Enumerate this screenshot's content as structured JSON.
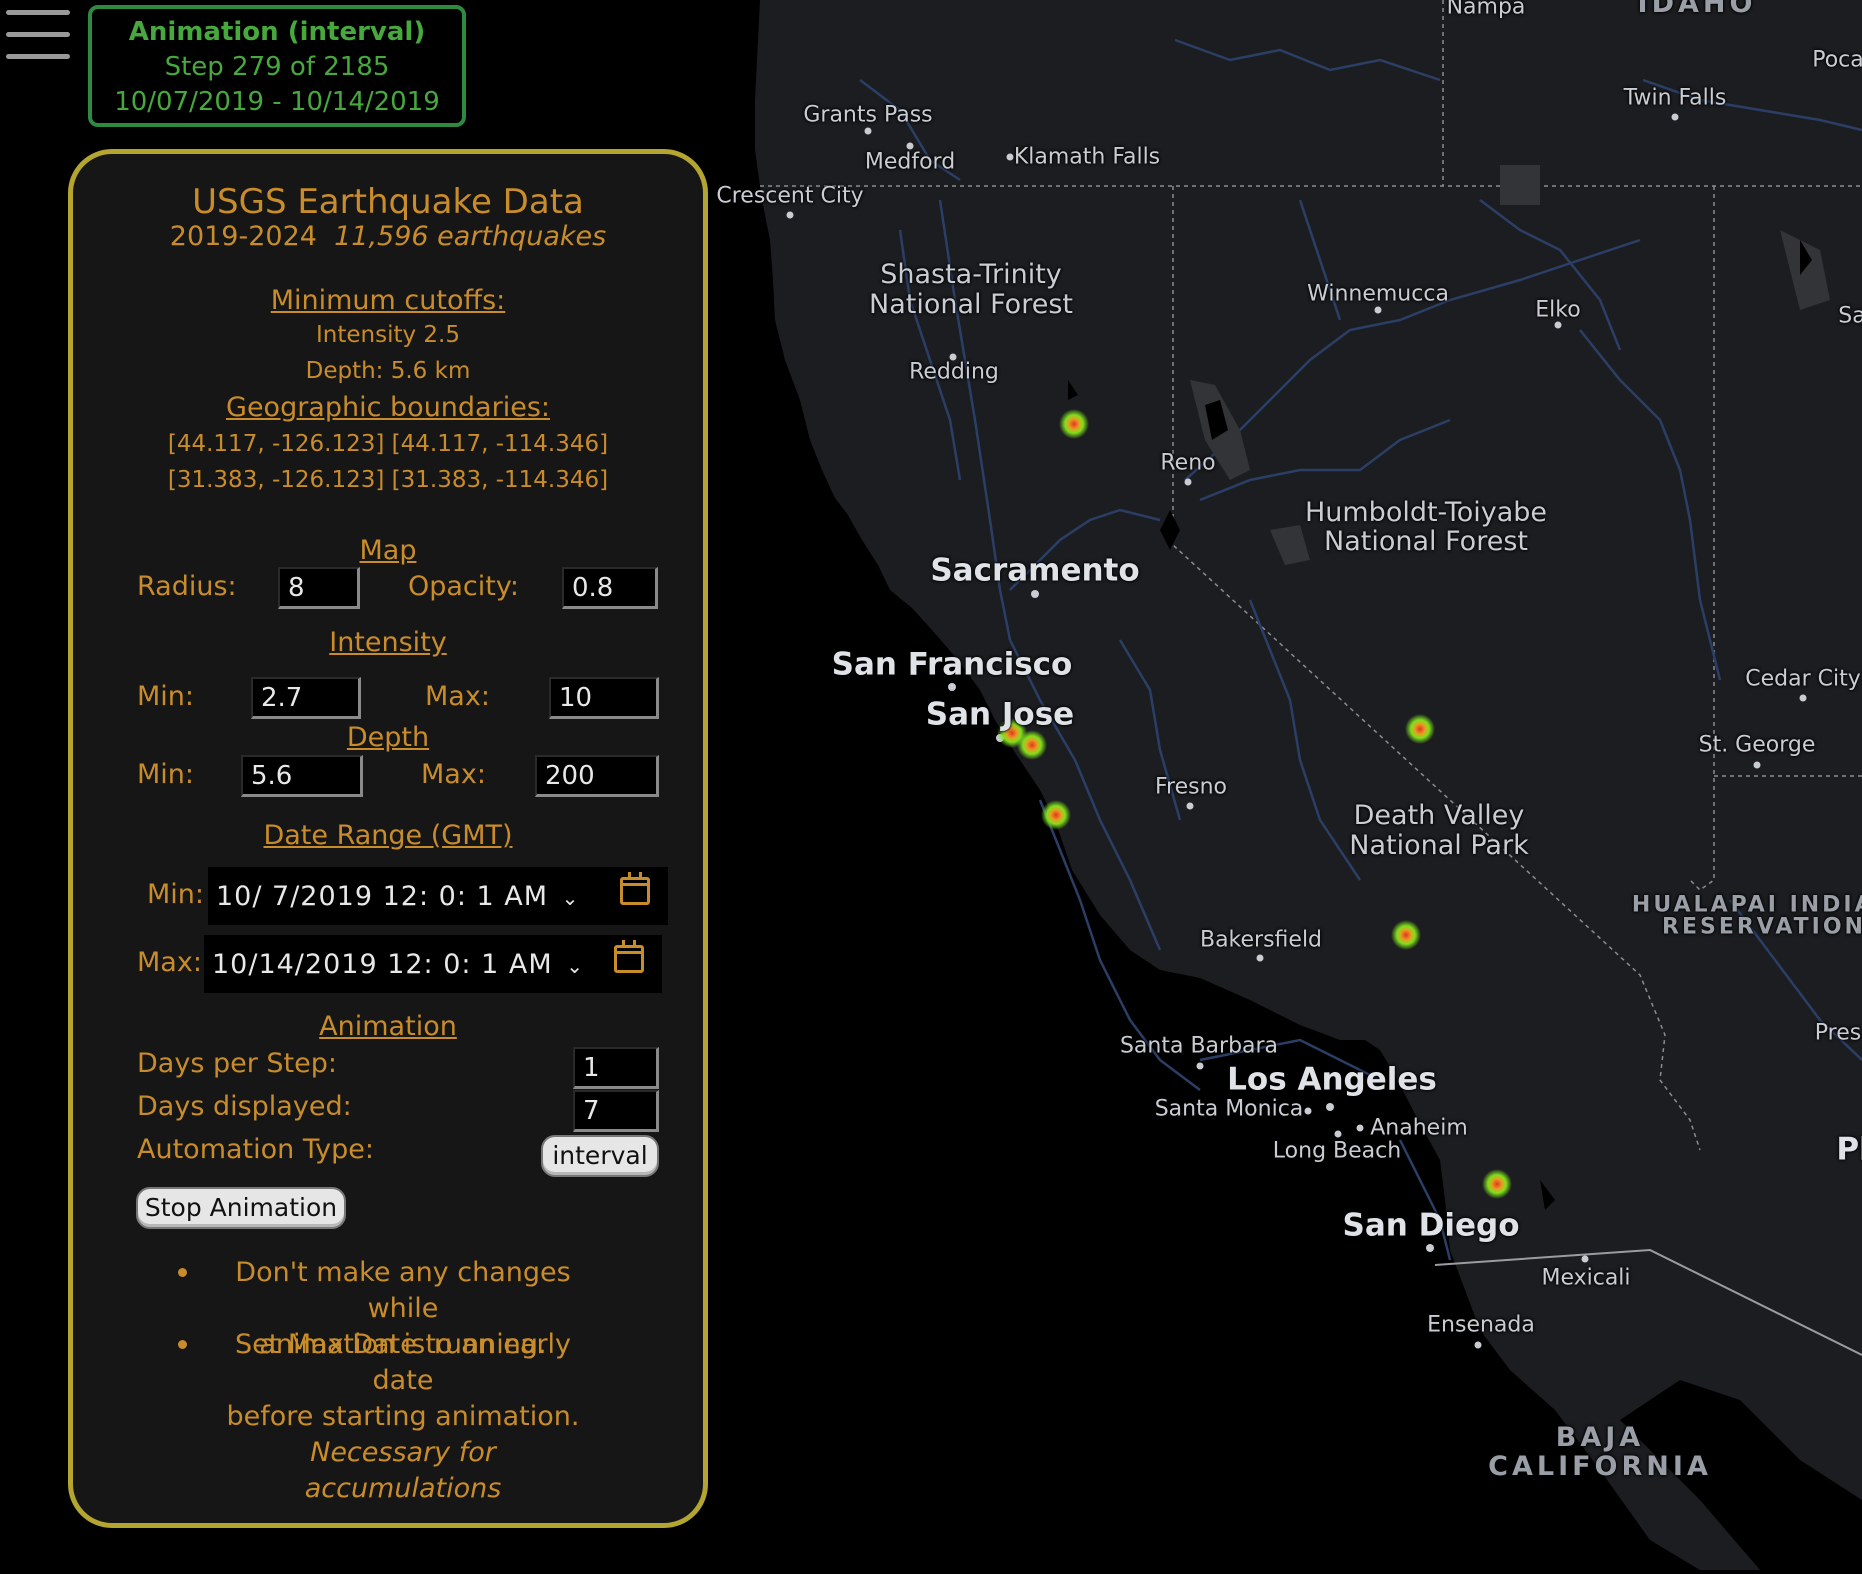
{
  "colors": {
    "panel_border": "#b3a530",
    "panel_text": "#c98c2b",
    "status_green": "#47a83d",
    "map_bg": "#1c1d20",
    "marker_core": "#e53421",
    "marker_halo": "#7fe01c"
  },
  "animation_status": {
    "title": "Animation (interval)",
    "step": "Step 279 of 2185",
    "range": "10/07/2019 - 10/14/2019"
  },
  "panel": {
    "title": "USGS Earthquake Data",
    "years": "2019-2024",
    "count": "11,596 earthquakes",
    "min_cutoffs": {
      "heading": "Minimum cutoffs:",
      "intensity": "Intensity 2.5",
      "depth": "Depth: 5.6 km"
    },
    "geo": {
      "heading": "Geographic boundaries:",
      "row1": "[44.117, -126.123] [44.117, -114.346]",
      "row2": "[31.383, -126.123] [31.383, -114.346]"
    },
    "map": {
      "heading": "Map",
      "radius_label": "Radius:",
      "radius": "8",
      "opacity_label": "Opacity:",
      "opacity": "0.8"
    },
    "intensity": {
      "heading": "Intensity",
      "min_label": "Min:",
      "min": "2.7",
      "max_label": "Max:",
      "max": "10"
    },
    "depth": {
      "heading": "Depth",
      "min_label": "Min:",
      "min": "5.6",
      "max_label": "Max:",
      "max": "200"
    },
    "date_range": {
      "heading": "Date Range (GMT)",
      "min_label": "Min:",
      "min_value": "10/ 7/2019 12: 0: 1 AM",
      "max_label": "Max:",
      "max_value": "10/14/2019 12: 0: 1 AM"
    },
    "animation": {
      "heading": "Animation",
      "days_step_label": "Days per Step:",
      "days_step": "1",
      "days_displayed_label": "Days displayed:",
      "days_displayed": "7",
      "type_label": "Automation Type:",
      "type_button": "interval",
      "stop_button": "Stop Animation"
    },
    "notes": {
      "n1a": "Don't make any changes while",
      "n1b": "animation is running.",
      "n2a": "Set Max Date to an early date",
      "n2b": "before starting animation.",
      "n2c": "Necessary for accumulations"
    }
  },
  "map_labels": {
    "nampa": "Nampa",
    "idaho": "IDAHO",
    "poca": "Poca",
    "twin_falls": "Twin Falls",
    "grants_pass": "Grants Pass",
    "medford": "Medford",
    "klamath_falls": "Klamath Falls",
    "crescent_city": "Crescent City",
    "shasta1": "Shasta-Trinity",
    "shasta2": "National Forest",
    "redding": "Redding",
    "winnemucca": "Winnemucca",
    "elko": "Elko",
    "sa": "Sa",
    "reno": "Reno",
    "humboldt1": "Humboldt-Toiyabe",
    "humboldt2": "National Forest",
    "sacramento": "Sacramento",
    "san_francisco": "San Francisco",
    "san_jose": "San Jose",
    "cedar_city": "Cedar City",
    "st_george": "St. George",
    "fresno": "Fresno",
    "death_valley1": "Death Valley",
    "death_valley2": "National Park",
    "hualapai1": "HUALAPAI INDIAN",
    "hualapai2": "RESERVATION",
    "bakersfield": "Bakersfield",
    "pres": "Pres",
    "santa_barbara": "Santa Barbara",
    "los_angeles": "Los Angeles",
    "santa_monica": "Santa Monica",
    "anaheim": "Anaheim",
    "long_beach": "Long Beach",
    "pl": "Pl",
    "san_diego": "San Diego",
    "mexicali": "Mexicali",
    "ensenada": "Ensenada",
    "baja1": "BAJA",
    "baja2": "CALIFORNIA"
  }
}
